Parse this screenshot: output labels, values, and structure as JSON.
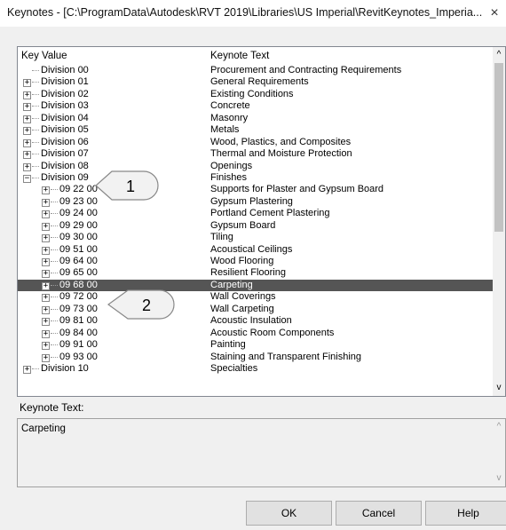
{
  "window": {
    "title": "Keynotes - [C:\\ProgramData\\Autodesk\\RVT 2019\\Libraries\\US Imperial\\RevitKeynotes_Imperia...",
    "close_glyph": "×"
  },
  "tree": {
    "column_key": "Key Value",
    "column_text": "Keynote Text",
    "rows": [
      {
        "key": "Division 00",
        "text": "Procurement and Contracting Requirements",
        "level": 0,
        "toggle": "",
        "selected": false
      },
      {
        "key": "Division 01",
        "text": "General Requirements",
        "level": 0,
        "toggle": "+",
        "selected": false
      },
      {
        "key": "Division 02",
        "text": "Existing Conditions",
        "level": 0,
        "toggle": "+",
        "selected": false
      },
      {
        "key": "Division 03",
        "text": "Concrete",
        "level": 0,
        "toggle": "+",
        "selected": false
      },
      {
        "key": "Division 04",
        "text": "Masonry",
        "level": 0,
        "toggle": "+",
        "selected": false
      },
      {
        "key": "Division 05",
        "text": "Metals",
        "level": 0,
        "toggle": "+",
        "selected": false
      },
      {
        "key": "Division 06",
        "text": "Wood, Plastics, and Composites",
        "level": 0,
        "toggle": "+",
        "selected": false
      },
      {
        "key": "Division 07",
        "text": "Thermal and Moisture Protection",
        "level": 0,
        "toggle": "+",
        "selected": false
      },
      {
        "key": "Division 08",
        "text": "Openings",
        "level": 0,
        "toggle": "+",
        "selected": false
      },
      {
        "key": "Division 09",
        "text": "Finishes",
        "level": 0,
        "toggle": "−",
        "selected": false
      },
      {
        "key": "09 22 00",
        "text": "Supports for Plaster and Gypsum Board",
        "level": 1,
        "toggle": "+",
        "selected": false
      },
      {
        "key": "09 23 00",
        "text": "Gypsum Plastering",
        "level": 1,
        "toggle": "+",
        "selected": false
      },
      {
        "key": "09 24 00",
        "text": "Portland Cement Plastering",
        "level": 1,
        "toggle": "+",
        "selected": false
      },
      {
        "key": "09 29 00",
        "text": "Gypsum Board",
        "level": 1,
        "toggle": "+",
        "selected": false
      },
      {
        "key": "09 30 00",
        "text": "Tiling",
        "level": 1,
        "toggle": "+",
        "selected": false
      },
      {
        "key": "09 51 00",
        "text": "Acoustical Ceilings",
        "level": 1,
        "toggle": "+",
        "selected": false
      },
      {
        "key": "09 64 00",
        "text": "Wood Flooring",
        "level": 1,
        "toggle": "+",
        "selected": false
      },
      {
        "key": "09 65 00",
        "text": "Resilient Flooring",
        "level": 1,
        "toggle": "+",
        "selected": false
      },
      {
        "key": "09 68 00",
        "text": "Carpeting",
        "level": 1,
        "toggle": "+",
        "selected": true
      },
      {
        "key": "09 72 00",
        "text": "Wall Coverings",
        "level": 1,
        "toggle": "+",
        "selected": false
      },
      {
        "key": "09 73 00",
        "text": "Wall Carpeting",
        "level": 1,
        "toggle": "+",
        "selected": false
      },
      {
        "key": "09 81 00",
        "text": "Acoustic Insulation",
        "level": 1,
        "toggle": "+",
        "selected": false
      },
      {
        "key": "09 84 00",
        "text": "Acoustic Room Components",
        "level": 1,
        "toggle": "+",
        "selected": false
      },
      {
        "key": "09 91 00",
        "text": "Painting",
        "level": 1,
        "toggle": "+",
        "selected": false
      },
      {
        "key": "09 93 00",
        "text": "Staining and Transparent Finishing",
        "level": 1,
        "toggle": "+",
        "selected": false
      },
      {
        "key": "Division 10",
        "text": "Specialties",
        "level": 0,
        "toggle": "+",
        "selected": false
      }
    ]
  },
  "keynote_text": {
    "label": "Keynote Text:",
    "value": "Carpeting"
  },
  "buttons": {
    "ok": "OK",
    "cancel": "Cancel",
    "help": "Help"
  },
  "callouts": {
    "one": "1",
    "two": "2"
  },
  "colors": {
    "selection": "#555555"
  }
}
